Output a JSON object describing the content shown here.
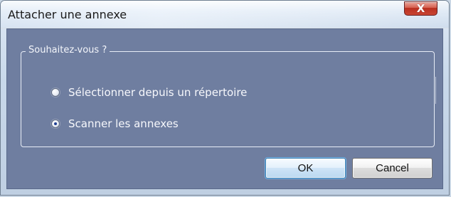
{
  "window": {
    "title": "Attacher une annexe"
  },
  "titlebar": {
    "close_icon": "X",
    "close_icon_name": "close-icon"
  },
  "group": {
    "title": "Souhaitez-vous ?"
  },
  "options": [
    {
      "label": "Sélectionner depuis un répertoire",
      "selected": false
    },
    {
      "label": "Scanner les annexes",
      "selected": true
    }
  ],
  "buttons": {
    "ok": "OK",
    "cancel": "Cancel"
  },
  "colors": {
    "panel": "#6f7ea0",
    "close_button": "#c94533",
    "ok_border": "#3c7fb1"
  }
}
